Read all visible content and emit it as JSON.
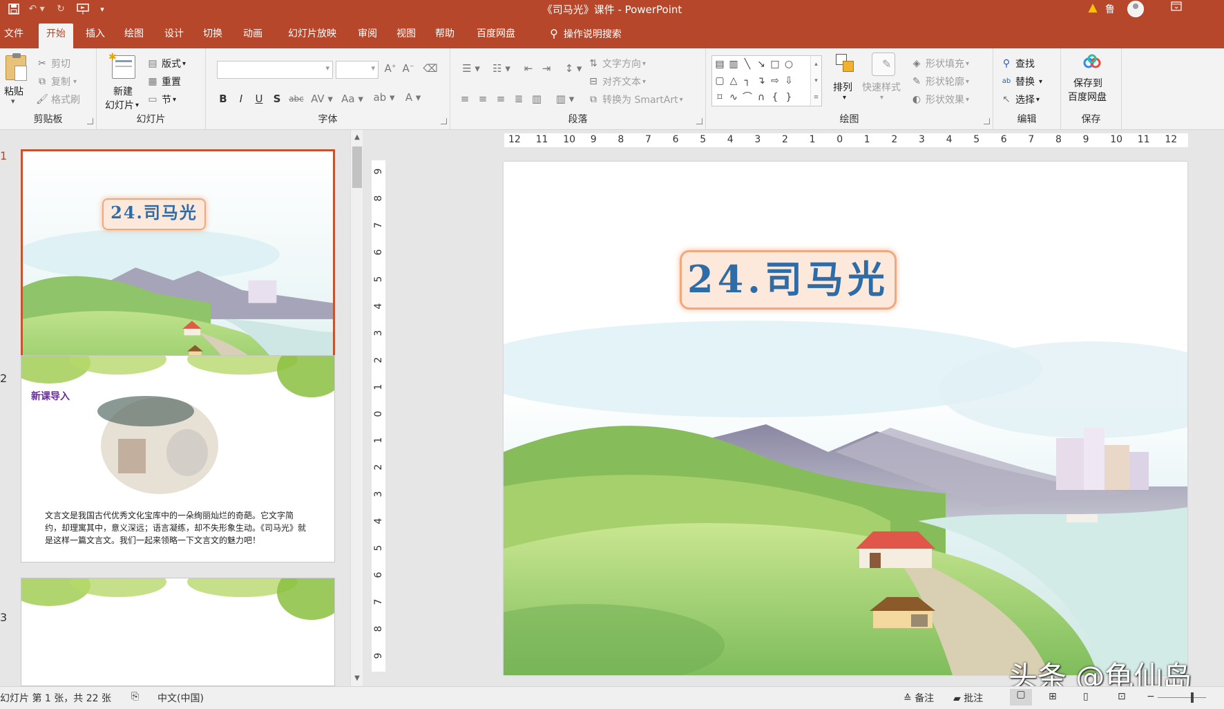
{
  "app": {
    "title": "《司马光》课件  -  PowerPoint",
    "user_initial": "鲁",
    "quick_access": [
      "save-icon",
      "undo-icon",
      "redo-icon",
      "present-icon",
      "customize-icon"
    ]
  },
  "tabs": [
    {
      "label": "文件"
    },
    {
      "label": "开始"
    },
    {
      "label": "插入"
    },
    {
      "label": "绘图"
    },
    {
      "label": "设计"
    },
    {
      "label": "切换"
    },
    {
      "label": "动画"
    },
    {
      "label": "幻灯片放映"
    },
    {
      "label": "审阅"
    },
    {
      "label": "视图"
    },
    {
      "label": "帮助"
    },
    {
      "label": "百度网盘"
    }
  ],
  "active_tab": "开始",
  "tell_me": "操作说明搜索",
  "ribbon": {
    "clipboard": {
      "label": "剪贴板",
      "paste": "粘贴",
      "cut": "剪切",
      "copy": "复制",
      "format_painter": "格式刷"
    },
    "slides": {
      "label": "幻灯片",
      "new_slide_line1": "新建",
      "new_slide_line2": "幻灯片",
      "layout": "版式",
      "reset": "重置",
      "section": "节"
    },
    "font": {
      "label": "字体",
      "font_name": "",
      "font_size": ""
    },
    "paragraph": {
      "label": "段落",
      "text_direction": "文字方向",
      "align_text": "对齐文本",
      "smartart": "转换为 SmartArt"
    },
    "drawing": {
      "label": "绘图",
      "arrange": "排列",
      "quick_styles": "快速样式",
      "shape_fill": "形状填充",
      "shape_outline": "形状轮廓",
      "shape_effects": "形状效果"
    },
    "editing": {
      "label": "编辑",
      "find": "查找",
      "replace": "替换",
      "select": "选择"
    },
    "save": {
      "label": "保存",
      "save_line1": "保存到",
      "save_line2": "百度网盘"
    }
  },
  "thumbnails": [
    {
      "number": "1",
      "title": "24.司马光",
      "selected": true
    },
    {
      "number": "2",
      "heading": "新课导入",
      "body": "文言文是我国古代优秀文化宝库中的一朵绚丽灿烂的奇葩。它文字简约，却理寓其中，意义深远；语言凝练，却不失形象生动。《司马光》就是这样一篇文言文。我们一起来领略一下文言文的魅力吧！",
      "selected": false
    },
    {
      "number": "3",
      "selected": false
    }
  ],
  "ruler": {
    "horizontal": [
      "12",
      "11",
      "10",
      "9",
      "8",
      "7",
      "6",
      "5",
      "4",
      "3",
      "2",
      "1",
      "0",
      "1",
      "2",
      "3",
      "4",
      "5",
      "6",
      "7",
      "8",
      "9",
      "10",
      "11",
      "12"
    ],
    "vertical": [
      "9",
      "8",
      "7",
      "6",
      "5",
      "4",
      "3",
      "2",
      "1",
      "0",
      "1",
      "2",
      "3",
      "4",
      "5",
      "6",
      "7",
      "8",
      "9"
    ]
  },
  "slide": {
    "title": "24.司马光"
  },
  "watermark": "头条 @龟仙岛",
  "status": {
    "slide_info": "幻灯片 第 1 张，共 22 张",
    "language": "中文(中国)",
    "notes": "备注",
    "comments": "批注"
  },
  "colors": {
    "brand": "#b7472a",
    "title_text": "#2e6ca8",
    "title_box": "#fde9dc",
    "title_border": "#f3a77c"
  }
}
